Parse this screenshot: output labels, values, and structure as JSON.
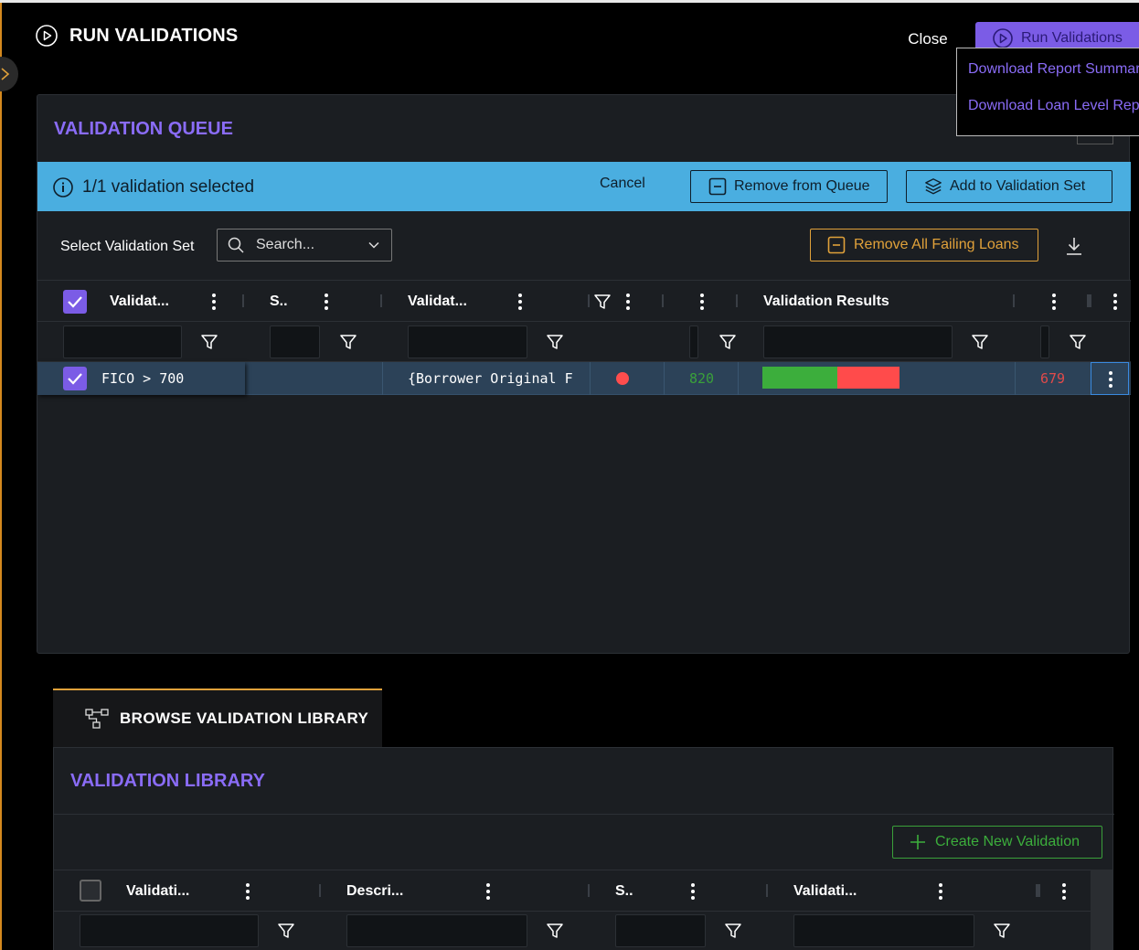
{
  "header": {
    "title": "RUN VALIDATIONS"
  },
  "actions": {
    "close_label": "Close",
    "run_label": "Run Validations"
  },
  "run_menu": {
    "items": [
      "Download Report Summary",
      "Download Loan Level Report"
    ]
  },
  "queue": {
    "title": "VALIDATION QUEUE",
    "selection_text": "1/1 validation selected",
    "cancel_label": "Cancel",
    "remove_label": "Remove from Queue",
    "add_set_label": "Add to Validation Set",
    "select_set_label": "Select Validation Set",
    "search_placeholder": "Search...",
    "remove_failing_label": "Remove All Failing Loans",
    "columns": [
      "Validat...",
      "S..",
      "Validat...",
      "Validation Results"
    ],
    "row": {
      "name": "FICO > 700",
      "expression": "{Borrower Original F",
      "status_color": "#ff4d4d",
      "passed": "820",
      "failed": "679",
      "pass_fraction": 0.547
    }
  },
  "library": {
    "tab_label": "BROWSE VALIDATION LIBRARY",
    "title": "VALIDATION LIBRARY",
    "create_label": "Create New Validation",
    "columns": [
      "Validati...",
      "Descri...",
      "S..",
      "Validati..."
    ]
  },
  "colors": {
    "accent": "#7b5ce6",
    "selection_bar": "#4aaee0",
    "warning": "#e0a13a",
    "success": "#3cae3c",
    "danger": "#ff4b4b"
  }
}
